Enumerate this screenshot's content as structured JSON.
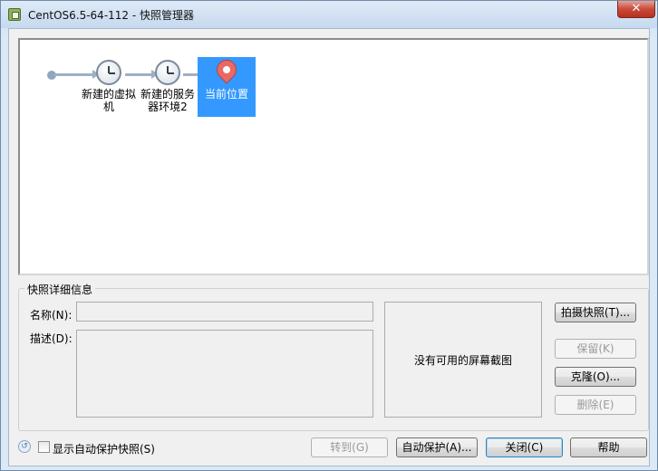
{
  "window": {
    "title": "CentOS6.5-64-112 - 快照管理器",
    "close_glyph": "✕"
  },
  "snapshots": [
    {
      "label_line1": "新建的虚拟",
      "label_line2": "机"
    },
    {
      "label_line1": "新建的服务",
      "label_line2": "器环境2"
    }
  ],
  "current": {
    "label": "当前位置"
  },
  "details": {
    "group_title": "快照详细信息",
    "name_label": "名称(N):",
    "desc_label": "描述(D):",
    "no_screenshot": "没有可用的屏幕截图"
  },
  "side_buttons": {
    "take_snapshot": "拍摄快照(T)...",
    "keep": "保留(K)",
    "clone": "克隆(O)...",
    "delete": "删除(E)"
  },
  "footer": {
    "show_auto_label": "显示自动保护快照(S)",
    "goto": "转到(G)",
    "autoprotect": "自动保护(A)...",
    "close": "关闭(C)",
    "help": "帮助"
  }
}
